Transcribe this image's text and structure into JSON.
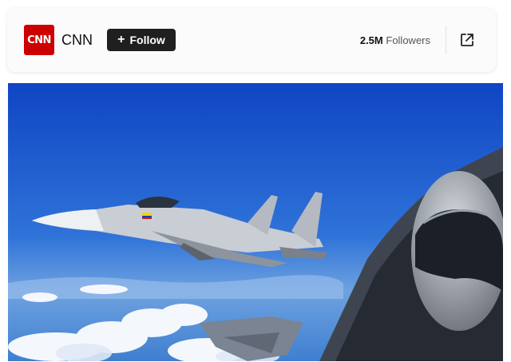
{
  "publisher": {
    "logo_text": "CNN",
    "name": "CNN",
    "brand_color": "#cc0000"
  },
  "follow_button": {
    "icon": "plus-icon",
    "label": "Follow"
  },
  "followers": {
    "count": "2.5M",
    "label": "Followers"
  },
  "share": {
    "icon": "external-link-icon"
  },
  "colors": {
    "button_bg": "#1f1f1f",
    "sky": "#1a4fb5"
  }
}
